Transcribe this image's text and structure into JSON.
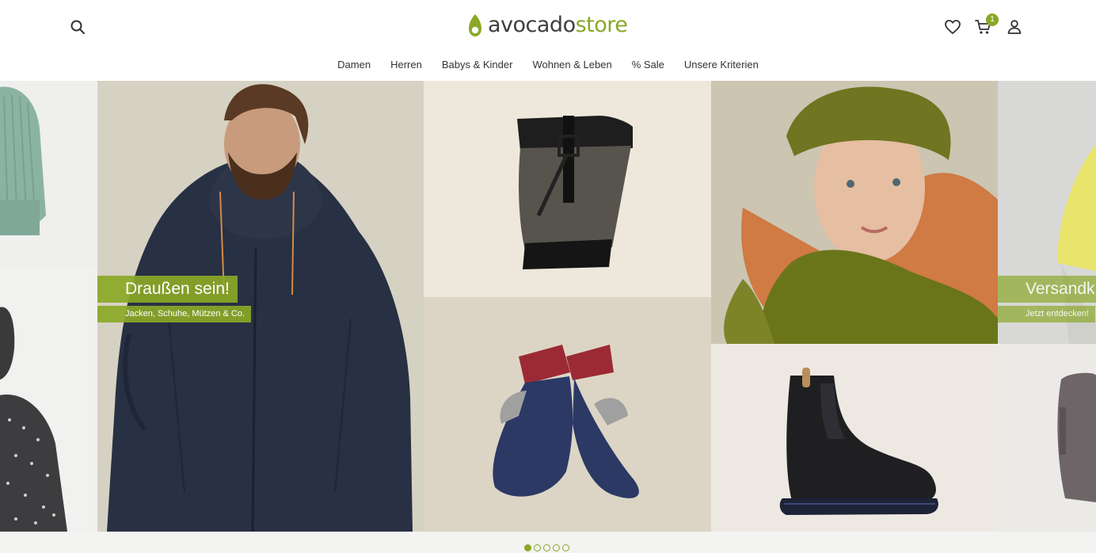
{
  "brand": {
    "name_part1": "avocado",
    "name_part2": "store",
    "accent_color": "#8aa827"
  },
  "header": {
    "icons": [
      "search-icon",
      "heart-icon",
      "cart-icon",
      "user-icon"
    ],
    "cart_count": "1"
  },
  "nav": {
    "items": [
      {
        "label": "Damen"
      },
      {
        "label": "Herren"
      },
      {
        "label": "Babys & Kinder"
      },
      {
        "label": "Wohnen & Leben"
      },
      {
        "label": "% Sale"
      },
      {
        "label": "Unsere Kriterien"
      }
    ]
  },
  "hero": {
    "promo_main": {
      "title": "Draußen sein!",
      "subtitle": "Jacken, Schuhe, Mützen & Co."
    },
    "promo_next": {
      "title": "Versandk",
      "subtitle": "Jetzt entdecken!"
    },
    "carousel": {
      "slides": 5,
      "active_slide": 1
    }
  }
}
